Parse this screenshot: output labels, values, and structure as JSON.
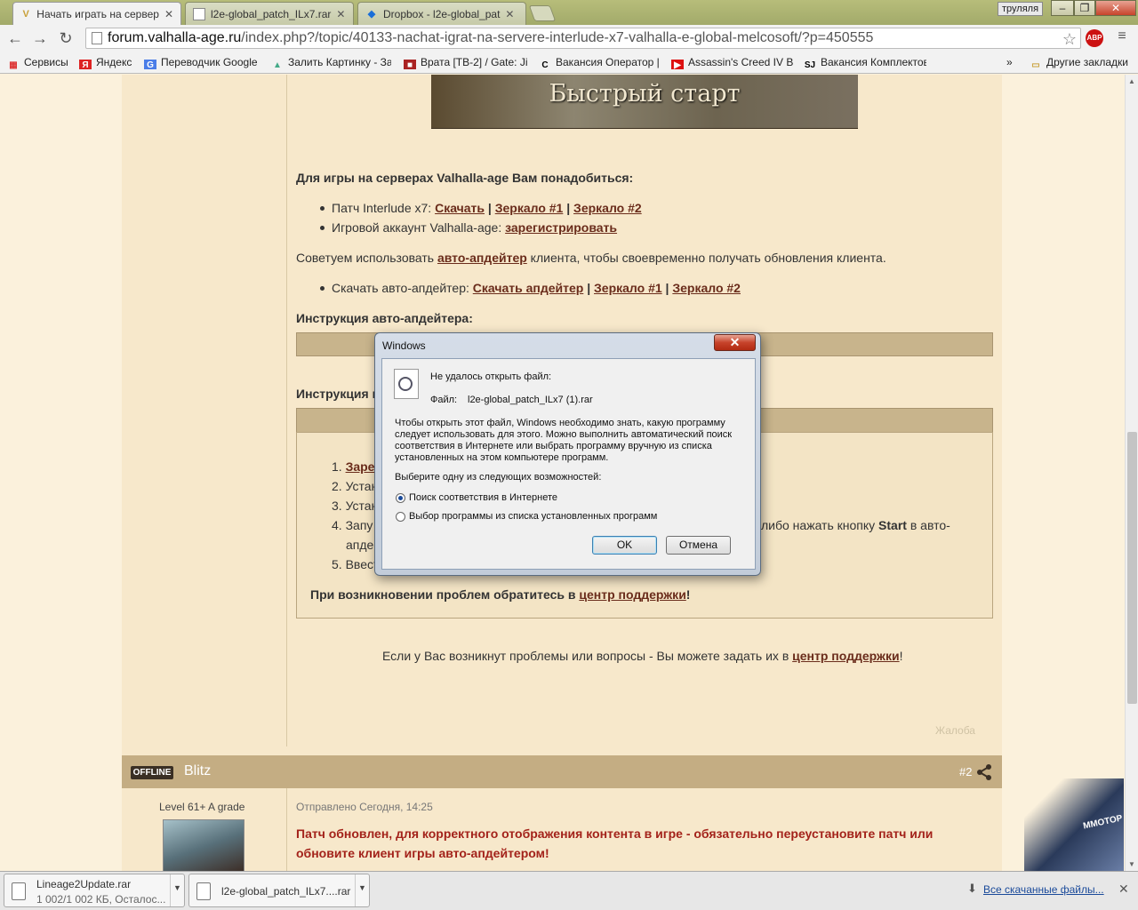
{
  "browser": {
    "tabs": [
      {
        "title": "Начать играть на сервер",
        "favicon": "V"
      },
      {
        "title": "l2e-global_patch_ILx7.rar",
        "favicon": "page"
      },
      {
        "title": "Dropbox - l2e-global_pat",
        "favicon": "dropbox"
      }
    ],
    "user_badge": "труляля",
    "url": {
      "host": "forum.valhalla-age.ru",
      "path": "/index.php?/topic/40133-nachat-igrat-na-servere-interlude-x7-valhalla-e-global-melcosoft/?p=450555"
    },
    "abp_label": "ABP",
    "bookmarks": [
      {
        "label": "Сервисы",
        "icon": "apps-grid-icon"
      },
      {
        "label": "Яндекс",
        "icon": "yandex-icon"
      },
      {
        "label": "Переводчик Google",
        "icon": "google-translate-icon"
      },
      {
        "label": "Залить Картинку - За",
        "icon": "upload-icon"
      },
      {
        "label": "Врата [ТВ-2] / Gate: Ji",
        "icon": "video-icon"
      },
      {
        "label": "Вакансия Оператор |",
        "icon": "c-icon"
      },
      {
        "label": "Assassin's Creed IV Bl",
        "icon": "youtube-icon"
      },
      {
        "label": "Вакансия Комплектов",
        "icon": "sj-icon"
      }
    ],
    "bookmarks_overflow": "»",
    "other_bookmarks": "Другие закладки"
  },
  "post": {
    "banner_title": "Быстрый старт",
    "heading": "Для игры на серверах Valhalla-age Вам понадобиться:",
    "patch_prefix": "Патч Interlude x7: ",
    "download_link": "Скачать",
    "mirror1": "Зеркало #1",
    "mirror2": "Зеркало #2",
    "sep": " | ",
    "account_prefix": "Игровой аккаунт Valhalla-age: ",
    "register_link": "зарегистрировать",
    "advice_prefix": "Советуем использовать ",
    "autoupdater_link": "авто-апдейтер",
    "advice_suffix": " клиента, чтобы своевременно получать обновления клиента.",
    "updater_prefix": "Скачать авто-апдейтер: ",
    "updater_download": "Скачать апдейтер",
    "instr_autoupdater": "Инструкция авто-апдейтера:",
    "instr2": "Инструкция п",
    "steps": [
      {
        "num": "1.",
        "text": "Заре"
      },
      {
        "num": "2.",
        "text": "Устан"
      },
      {
        "num": "3.",
        "text": "Устан"
      },
      {
        "num": "4.",
        "text": "Запу"
      },
      {
        "num": "5.",
        "text": "Ввест"
      }
    ],
    "step4_end": "либо нажать кнопку ",
    "step4_start": "Start",
    "step4_tail": " в авто-",
    "step4_cont": "апде",
    "problems_prefix": "При возникновении проблем обратитесь в ",
    "support_link": "центр поддержки",
    "excl": "!",
    "questions_prefix": "Если у Вас возникнут проблемы или вопросы - Вы можете задать их в ",
    "report": "Жалоба"
  },
  "post2": {
    "status": "OFFLINE",
    "author": "Blitz",
    "number": "#2",
    "grade": "Level 61+ A grade",
    "date": "Отправлено Сегодня, 14:25",
    "message_line1": "Патч обновлен, для корректного отображения контента в игре - обязательно переустановите патч или",
    "message_line2": "обновите клиент игры авто-апдейтером!"
  },
  "ad": {
    "text": "MMOTOP"
  },
  "dialog": {
    "title": "Windows",
    "close_glyph": "✕",
    "cannot_open": "Не удалось открыть файл:",
    "file_label": "Файл:",
    "file_name": "l2e-global_patch_ILx7 (1).rar",
    "explanation": [
      "Чтобы открыть этот файл, Windows необходимо знать, какую программу",
      "следует использовать для этого. Можно выполнить автоматический поиск",
      "соответствия в Интернете или выбрать программу вручную из списка",
      "установленных на этом компьютере программ."
    ],
    "choose": "Выберите одну из следующих возможностей:",
    "options": [
      {
        "label": "Поиск соответствия в Интернете",
        "selected": true
      },
      {
        "label": "Выбор программы из списка установленных программ",
        "selected": false
      }
    ],
    "ok": "OK",
    "cancel": "Отмена"
  },
  "downloads": {
    "items": [
      {
        "name": "Lineage2Update.rar",
        "status": "1 002/1 002 КБ, Осталос..."
      },
      {
        "name": "l2e-global_patch_ILx7....rar",
        "status": ""
      }
    ],
    "all_link": "Все скачанные файлы..."
  },
  "colors": {
    "link": "#6a2c1b",
    "accent_bar": "#c4ad83",
    "post_bg": "#f7e8cb",
    "alert_text": "#a3221a"
  }
}
